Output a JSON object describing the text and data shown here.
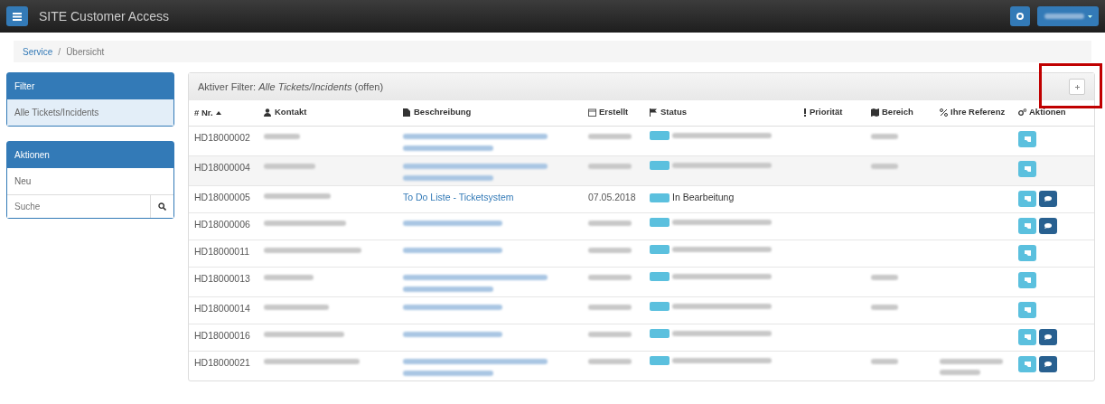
{
  "navbar": {
    "title": "SITE Customer Access"
  },
  "breadcrumb": {
    "items": [
      "Service",
      "Übersicht"
    ],
    "separator": "/"
  },
  "filter_panel": {
    "title": "Filter",
    "items": [
      {
        "label": "Alle Tickets/Incidents",
        "selected": true
      }
    ]
  },
  "actions_panel": {
    "title": "Aktionen",
    "items": [
      "Neu"
    ],
    "search": {
      "placeholder": "Suche"
    }
  },
  "table_panel": {
    "filter_label": "Aktiver Filter:",
    "filter_value": "Alle Tickets/Incidents",
    "filter_suffix": "(offen)"
  },
  "columns": [
    {
      "label": "# Nr.",
      "kind": "nr",
      "sorted_ascending": true
    },
    {
      "label": "Kontakt",
      "kind": "person"
    },
    {
      "label": "Beschreibung",
      "kind": "doc"
    },
    {
      "label": "Erstellt",
      "kind": "calendar"
    },
    {
      "label": "Status",
      "kind": "flag"
    },
    {
      "label": "Priorität",
      "kind": "excl"
    },
    {
      "label": "Bereich",
      "kind": "map"
    },
    {
      "label": "Ihre Referenz",
      "kind": "percent"
    },
    {
      "label": "Aktionen",
      "kind": "gears"
    }
  ],
  "rows": [
    {
      "nr": "HD18000002",
      "wrap": true,
      "area_blurred": true,
      "comment": false
    },
    {
      "nr": "HD18000004",
      "wrap": true,
      "area_blurred": true,
      "comment": false
    },
    {
      "nr": "HD18000005",
      "description": "To Do Liste - Ticketsystem",
      "created": "07.05.2018",
      "status": "In Bearbeitung",
      "comment": true
    },
    {
      "nr": "HD18000006",
      "comment": true
    },
    {
      "nr": "HD18000011",
      "comment": false
    },
    {
      "nr": "HD18000013",
      "wrap": true,
      "area_blurred": true,
      "comment": false
    },
    {
      "nr": "HD18000014",
      "area_blurred": true,
      "comment": false
    },
    {
      "nr": "HD18000016",
      "comment": true
    },
    {
      "nr": "HD18000021",
      "wrap": true,
      "area_blurred": true,
      "reference_blurred": true,
      "comment": true
    }
  ]
}
